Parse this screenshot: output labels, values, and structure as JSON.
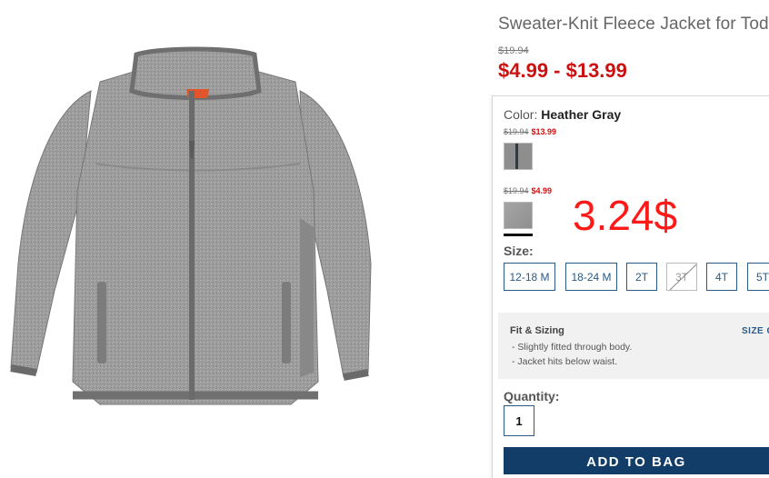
{
  "product": {
    "title": "Sweater-Knit Fleece Jacket for Toddler",
    "original_price": "$19.94",
    "sale_range": "$4.99 - $13.99"
  },
  "color": {
    "label": "Color:",
    "selected": "Heather Gray",
    "swatches": [
      {
        "old_price": "$19.94",
        "new_price": "$13.99",
        "color": "#2f3a44"
      },
      {
        "old_price": "$19.94",
        "new_price": "$4.99",
        "color": "#9a9a9a"
      }
    ]
  },
  "annotation": "3.24$",
  "size": {
    "label": "Size:",
    "options": [
      {
        "label": "12-18 M",
        "available": true
      },
      {
        "label": "18-24 M",
        "available": true
      },
      {
        "label": "2T",
        "available": true
      },
      {
        "label": "3T",
        "available": false
      },
      {
        "label": "4T",
        "available": true
      },
      {
        "label": "5T",
        "available": true
      }
    ]
  },
  "fit": {
    "title": "Fit & Sizing",
    "items": [
      "- Slightly fitted through body.",
      "- Jacket hits below waist."
    ],
    "size_chart_link": "SIZE CHART"
  },
  "quantity": {
    "label": "Quantity:",
    "value": "1"
  },
  "add_to_bag": "ADD TO BAG",
  "colors": {
    "sale_red": "#cc1111",
    "navy": "#123d68",
    "link_blue": "#2a5a85"
  }
}
